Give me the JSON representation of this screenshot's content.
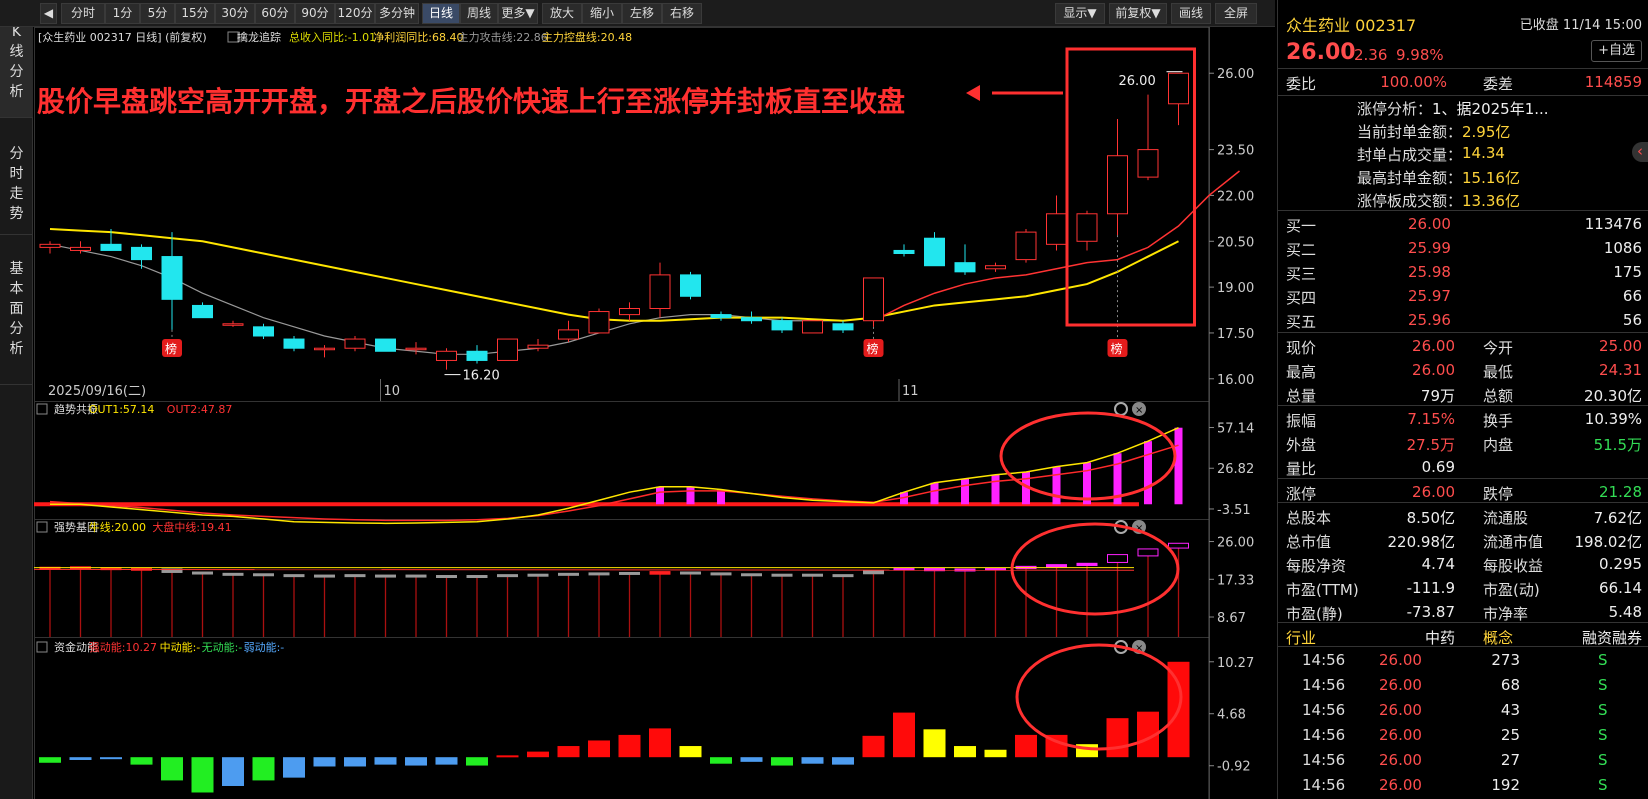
{
  "toolbar": {
    "periods": [
      "分时",
      "1分",
      "5分",
      "15分",
      "30分",
      "60分",
      "90分",
      "120分",
      "多分钟",
      "日线",
      "周线",
      "更多▼",
      "放大",
      "缩小",
      "左移",
      "右移"
    ],
    "active": "日线",
    "right": [
      "显示▼",
      "前复权▼",
      "画线",
      "全屏"
    ]
  },
  "leftnav": [
    "K线分析",
    "分时走势",
    "基本面分析"
  ],
  "main_header": {
    "title": "[众生药业 002317 日线]  (前复权)",
    "ind_name": "擒龙追踪",
    "items": [
      {
        "t": "总收入同比:-1.01",
        "c": "#dddd00"
      },
      {
        "t": "净利润同比:68.40",
        "c": "#ffd43a"
      },
      {
        "t": "主力攻击线:22.86",
        "c": "#999999"
      },
      {
        "t": "主力控盘线:20.48",
        "c": "#ffd43a"
      }
    ]
  },
  "annotation": "股价早盘跳空高开开盘，开盘之后股价快速上行至涨停并封板直至收盘",
  "chart_data": {
    "type": "candlestick",
    "price_axis": [
      "26.00",
      "23.50",
      "22.00",
      "20.50",
      "19.00",
      "17.50",
      "16.00"
    ],
    "ylim": [
      15.6,
      26.4
    ],
    "candles": [
      [
        20.3,
        20.4,
        20.1,
        20.5
      ],
      [
        20.2,
        20.3,
        20.1,
        20.5
      ],
      [
        20.4,
        20.2,
        20.2,
        20.9
      ],
      [
        20.3,
        19.9,
        19.6,
        20.4
      ],
      [
        20.0,
        18.6,
        17.6,
        20.8
      ],
      [
        18.4,
        18.0,
        18.0,
        18.5
      ],
      [
        17.8,
        17.8,
        17.7,
        17.9
      ],
      [
        17.7,
        17.4,
        17.3,
        17.8
      ],
      [
        17.3,
        17.0,
        16.9,
        17.4
      ],
      [
        17.0,
        17.0,
        16.7,
        17.1
      ],
      [
        17.0,
        17.3,
        16.9,
        17.4
      ],
      [
        17.3,
        16.9,
        16.9,
        17.3
      ],
      [
        17.0,
        17.0,
        16.8,
        17.2
      ],
      [
        16.6,
        16.9,
        16.3,
        17.0
      ],
      [
        16.9,
        16.6,
        16.5,
        17.1
      ],
      [
        16.6,
        17.3,
        16.6,
        17.3
      ],
      [
        17.0,
        17.1,
        16.9,
        17.3
      ],
      [
        17.3,
        17.6,
        17.2,
        17.9
      ],
      [
        17.5,
        18.2,
        17.5,
        18.3
      ],
      [
        18.1,
        18.3,
        17.9,
        18.5
      ],
      [
        18.3,
        19.4,
        18.0,
        19.8
      ],
      [
        19.4,
        18.7,
        18.6,
        19.5
      ],
      [
        18.1,
        18.0,
        17.9,
        18.2
      ],
      [
        18.0,
        17.9,
        17.8,
        18.2
      ],
      [
        17.9,
        17.6,
        17.5,
        18.0
      ],
      [
        17.5,
        17.9,
        17.5,
        17.9
      ],
      [
        17.8,
        17.6,
        17.5,
        17.9
      ],
      [
        17.9,
        19.3,
        17.7,
        19.3
      ],
      [
        20.2,
        20.1,
        20.0,
        20.4
      ],
      [
        20.6,
        19.7,
        19.7,
        20.8
      ],
      [
        19.8,
        19.5,
        19.4,
        20.4
      ],
      [
        19.6,
        19.7,
        19.5,
        19.8
      ],
      [
        19.9,
        20.8,
        19.8,
        20.9
      ],
      [
        20.4,
        21.4,
        20.2,
        22.0
      ],
      [
        20.5,
        21.4,
        20.2,
        21.5
      ],
      [
        21.4,
        23.3,
        20.7,
        24.5
      ],
      [
        22.6,
        23.5,
        22.5,
        25.3
      ],
      [
        25.0,
        26.0,
        24.3,
        26.0
      ]
    ],
    "ma_red_start": 27,
    "ma_red": [
      17.9,
      18.4,
      18.8,
      19.1,
      19.3,
      19.4,
      19.6,
      19.8,
      19.9,
      20.3,
      21.0,
      22.0,
      22.8
    ],
    "ma_gray": [
      20.4,
      20.2,
      20.0,
      19.7,
      19.3,
      18.8,
      18.4,
      18.0,
      17.7,
      17.4,
      17.2,
      17.0,
      16.9,
      16.8,
      16.8,
      16.9,
      17.0,
      17.2,
      17.5,
      17.8,
      18.0,
      18.1,
      18.1,
      18.0,
      17.9,
      17.9,
      17.9
    ],
    "ma_yellow": [
      20.9,
      20.85,
      20.8,
      20.7,
      20.6,
      20.5,
      20.3,
      20.1,
      19.9,
      19.7,
      19.5,
      19.3,
      19.1,
      18.9,
      18.7,
      18.5,
      18.3,
      18.1,
      17.95,
      17.9,
      17.9,
      17.95,
      18.0,
      18.0,
      18.0,
      17.95,
      17.9,
      18.0,
      18.2,
      18.4,
      18.5,
      18.6,
      18.7,
      18.9,
      19.1,
      19.5,
      20.0,
      20.5
    ],
    "x_labels": [
      "2025/09/16(二)",
      "10",
      "11"
    ],
    "rank_badge": "榜",
    "rank_at": [
      4,
      27,
      35
    ],
    "high_label": "26.00",
    "low_label": "16.20",
    "low_index": 13,
    "ind1": {
      "name": "趋势共振",
      "out1": "OUT1:57.14",
      "out2": "OUT2:47.87",
      "axis": [
        "57.14",
        "26.82",
        "-3.51"
      ],
      "ylim": [
        -8,
        62
      ],
      "out1_vals": [
        0,
        0,
        -2,
        -4,
        -6,
        -8,
        -9,
        -11,
        -13,
        -13.5,
        -14,
        -14.2,
        -14,
        -13.5,
        -13,
        -11,
        -8,
        -3,
        3,
        9,
        13,
        13,
        11,
        8,
        5,
        3,
        2,
        1,
        9,
        16,
        19,
        22,
        24,
        28,
        31,
        38,
        47,
        57
      ],
      "out2_vals": [
        2,
        0.5,
        -1,
        -2.5,
        -4.5,
        -6.5,
        -8,
        -9,
        -10,
        -11,
        -11.5,
        -12,
        -12,
        -12,
        -11.5,
        -10.5,
        -8.5,
        -5,
        -1,
        4,
        9,
        10,
        10,
        8,
        6,
        4,
        2.5,
        1.5,
        5,
        10,
        14,
        17,
        19,
        22,
        25,
        30,
        37,
        44
      ],
      "bars": [
        0,
        0,
        0,
        0,
        0,
        0,
        0,
        0,
        0,
        0,
        0,
        0,
        0,
        0,
        0,
        0,
        0,
        0,
        0,
        0,
        1,
        1,
        1,
        0,
        0,
        0,
        0,
        0,
        1,
        1,
        1,
        1,
        1,
        1,
        1,
        1,
        1,
        1
      ]
    },
    "ind2": {
      "name": "强势基因",
      "t1": "牛线:20.00",
      "t2": "大盘中线:19.41",
      "axis": [
        "26.00",
        "17.33",
        "8.67"
      ],
      "ylim": [
        5,
        27.5
      ],
      "boxes": [
        [
          19.6,
          20.1,
          "r"
        ],
        [
          19.7,
          20.2,
          "r"
        ],
        [
          19.6,
          20.0,
          "r"
        ],
        [
          19.4,
          19.9,
          "r"
        ],
        [
          18.9,
          19.7,
          "g"
        ],
        [
          18.7,
          19.0,
          "g"
        ],
        [
          18.5,
          18.7,
          "g"
        ],
        [
          18.3,
          18.6,
          "g"
        ],
        [
          18.2,
          18.4,
          "g"
        ],
        [
          18.1,
          18.3,
          "g"
        ],
        [
          18.2,
          18.4,
          "g"
        ],
        [
          18.1,
          18.3,
          "g"
        ],
        [
          18.1,
          18.3,
          "g"
        ],
        [
          17.9,
          18.2,
          "g"
        ],
        [
          18.0,
          18.2,
          "g"
        ],
        [
          18.1,
          18.4,
          "g"
        ],
        [
          18.2,
          18.5,
          "g"
        ],
        [
          18.4,
          18.7,
          "g"
        ],
        [
          18.5,
          18.8,
          "g"
        ],
        [
          18.6,
          18.9,
          "g"
        ],
        [
          18.5,
          19.1,
          "r"
        ],
        [
          18.7,
          19.0,
          "g"
        ],
        [
          18.5,
          18.8,
          "g"
        ],
        [
          18.4,
          18.6,
          "g"
        ],
        [
          18.3,
          18.5,
          "g"
        ],
        [
          18.3,
          18.5,
          "g"
        ],
        [
          18.2,
          18.4,
          "g"
        ],
        [
          18.6,
          19.3,
          "g"
        ],
        [
          19.5,
          19.9,
          "m"
        ],
        [
          19.3,
          19.9,
          "m"
        ],
        [
          19.4,
          19.7,
          "m"
        ],
        [
          19.6,
          19.9,
          "m"
        ],
        [
          19.8,
          20.3,
          "m"
        ],
        [
          20.1,
          20.7,
          "m"
        ],
        [
          20.5,
          21.0,
          "m"
        ],
        [
          21.2,
          23.0,
          "m"
        ],
        [
          22.7,
          24.3,
          "m"
        ],
        [
          24.5,
          25.6,
          "m"
        ]
      ]
    },
    "ind3": {
      "name": "资金动能",
      "s": "强动能:10.27",
      "m": "中动能:-",
      "n": "无动能:-",
      "w": "弱动能:-",
      "axis": [
        "10.27",
        "4.68",
        "-0.92"
      ],
      "ylim": [
        -4.5,
        11
      ],
      "bars": [
        [
          -0.6,
          "g"
        ],
        [
          -0.3,
          "b"
        ],
        [
          -0.2,
          "b"
        ],
        [
          -0.8,
          "g"
        ],
        [
          -2.5,
          "g"
        ],
        [
          -3.8,
          "g"
        ],
        [
          -3.1,
          "b"
        ],
        [
          -2.5,
          "g"
        ],
        [
          -2.2,
          "b"
        ],
        [
          -1.0,
          "b"
        ],
        [
          -1.0,
          "b"
        ],
        [
          -0.8,
          "b"
        ],
        [
          -0.9,
          "b"
        ],
        [
          -0.8,
          "b"
        ],
        [
          -0.9,
          "g"
        ],
        [
          0.2,
          "r"
        ],
        [
          0.6,
          "r"
        ],
        [
          1.2,
          "r"
        ],
        [
          1.8,
          "r"
        ],
        [
          2.4,
          "r"
        ],
        [
          3.1,
          "r"
        ],
        [
          1.2,
          "y"
        ],
        [
          -0.7,
          "g"
        ],
        [
          -0.5,
          "b"
        ],
        [
          -0.9,
          "g"
        ],
        [
          -0.7,
          "b"
        ],
        [
          -0.8,
          "b"
        ],
        [
          2.3,
          "r"
        ],
        [
          4.8,
          "r"
        ],
        [
          3.0,
          "y"
        ],
        [
          1.2,
          "y"
        ],
        [
          0.8,
          "y"
        ],
        [
          2.4,
          "r"
        ],
        [
          2.4,
          "r"
        ],
        [
          1.4,
          "y"
        ],
        [
          4.2,
          "r"
        ],
        [
          4.9,
          "r"
        ],
        [
          10.27,
          "r"
        ]
      ]
    }
  },
  "right_panel": {
    "stock": "众生药业 002317",
    "status": "已收盘 11/14 15:00",
    "price": "26.00",
    "chg": "2.36",
    "pct": "9.98%",
    "fav": "+自选",
    "weibi": {
      "l": "委比",
      "v": "100.00%",
      "l2": "委差",
      "v2": "114859"
    },
    "limit_rows": [
      {
        "l": "涨停分析：",
        "v": "1、据2025年1...",
        "c": "wht"
      },
      {
        "l": "当前封单金额：",
        "v": "2.95亿",
        "c": "yel"
      },
      {
        "l": "封单占成交量：",
        "v": "14.34",
        "c": "yel"
      },
      {
        "l": "最高封单金额：",
        "v": "15.16亿",
        "c": "yel"
      },
      {
        "l": "涨停板成交额：",
        "v": "13.36亿",
        "c": "yel"
      }
    ],
    "bids": [
      {
        "l": "买一",
        "p": "26.00",
        "v": "113476"
      },
      {
        "l": "买二",
        "p": "25.99",
        "v": "1086"
      },
      {
        "l": "买三",
        "p": "25.98",
        "v": "175"
      },
      {
        "l": "买四",
        "p": "25.97",
        "v": "66"
      },
      {
        "l": "买五",
        "p": "25.96",
        "v": "56"
      }
    ],
    "quote": [
      [
        {
          "l": "现价",
          "v": "26.00",
          "c": "red"
        },
        {
          "l": "今开",
          "v": "25.00",
          "c": "red"
        }
      ],
      [
        {
          "l": "最高",
          "v": "26.00",
          "c": "red"
        },
        {
          "l": "最低",
          "v": "24.31",
          "c": "red"
        }
      ],
      [
        {
          "l": "总量",
          "v": "79万",
          "c": "wht"
        },
        {
          "l": "总额",
          "v": "20.30亿",
          "c": "wht"
        }
      ]
    ],
    "quote2": [
      [
        {
          "l": "振幅",
          "v": "7.15%",
          "c": "red"
        },
        {
          "l": "换手",
          "v": "10.39%",
          "c": "wht"
        }
      ],
      [
        {
          "l": "外盘",
          "v": "27.5万",
          "c": "red"
        },
        {
          "l": "内盘",
          "v": "51.5万",
          "c": "grn"
        }
      ],
      [
        {
          "l": "量比",
          "v": "0.69",
          "c": "wht"
        },
        {
          "l": "",
          "v": "",
          "c": "wht"
        }
      ]
    ],
    "quote3": [
      [
        {
          "l": "涨停",
          "v": "26.00",
          "c": "red"
        },
        {
          "l": "跌停",
          "v": "21.28",
          "c": "grn"
        }
      ]
    ],
    "fund": [
      [
        {
          "l": "总股本",
          "v": "8.50亿"
        },
        {
          "l": "流通股",
          "v": "7.62亿"
        }
      ],
      [
        {
          "l": "总市值",
          "v": "220.98亿"
        },
        {
          "l": "流通市值",
          "v": "198.02亿"
        }
      ],
      [
        {
          "l": "每股净资",
          "v": "4.74"
        },
        {
          "l": "每股收益",
          "v": "0.295"
        }
      ],
      [
        {
          "l": "市盈(TTM)",
          "v": "-111.9"
        },
        {
          "l": "市盈(动)",
          "v": "66.14"
        }
      ],
      [
        {
          "l": "市盈(静)",
          "v": "-73.87"
        },
        {
          "l": "市净率",
          "v": "5.48"
        }
      ]
    ],
    "cat": {
      "a": "行业",
      "b": "中药",
      "c": "概念",
      "d": "融资融券"
    },
    "ticks": [
      [
        "14:56",
        "26.00",
        "273",
        "S"
      ],
      [
        "14:56",
        "26.00",
        "68",
        "S"
      ],
      [
        "14:56",
        "26.00",
        "43",
        "S"
      ],
      [
        "14:56",
        "26.00",
        "25",
        "S"
      ],
      [
        "14:56",
        "26.00",
        "27",
        "S"
      ],
      [
        "14:56",
        "26.00",
        "192",
        "S"
      ]
    ]
  }
}
